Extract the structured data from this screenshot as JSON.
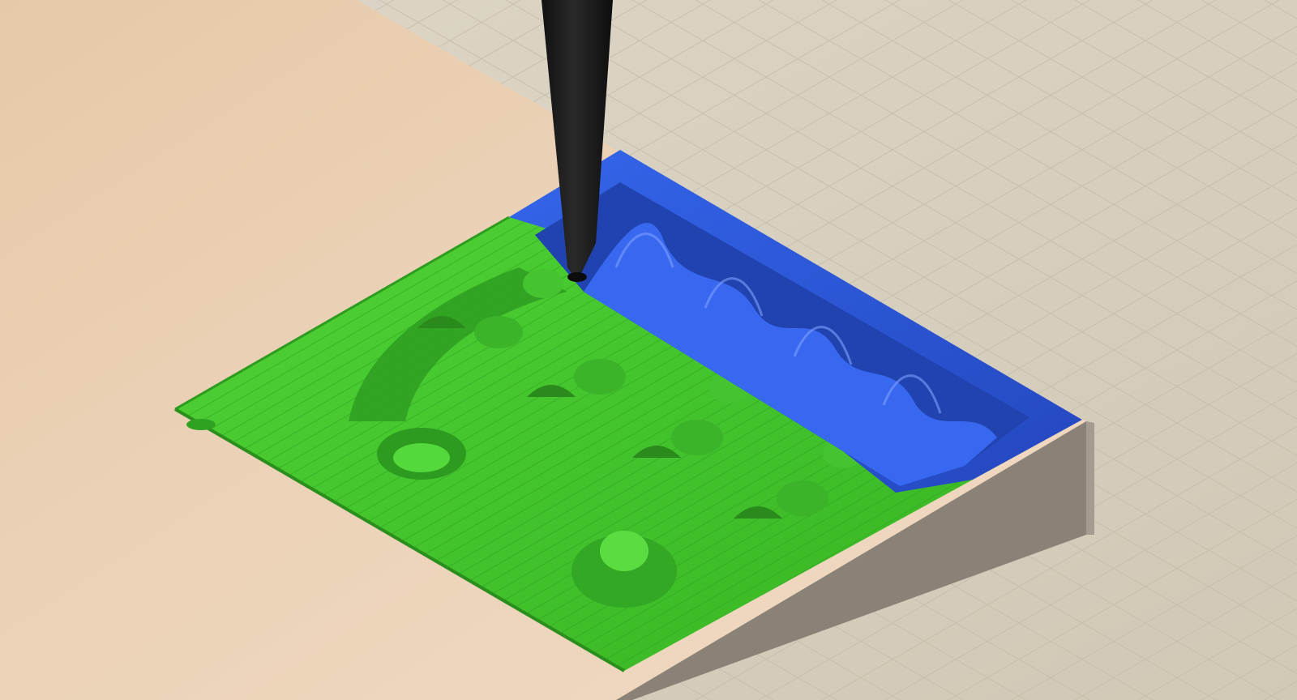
{
  "view": {
    "kind": "cam-toolpath-simulation",
    "colors": {
      "background_floor": "#d6cfbe",
      "grid_line": "#c2bba9",
      "stock_top": "#ecd2b6",
      "stock_side": "#8b8277",
      "stock_side_light": "#a59c90",
      "machined_area": "#44c92d",
      "machined_area_dark": "#2d9c1f",
      "current_operation": "#2f5ee0",
      "current_operation_dark": "#1f3fa8",
      "tool": "#1b1b1b"
    },
    "icons": {
      "tool": "end-mill-tool-icon"
    }
  }
}
